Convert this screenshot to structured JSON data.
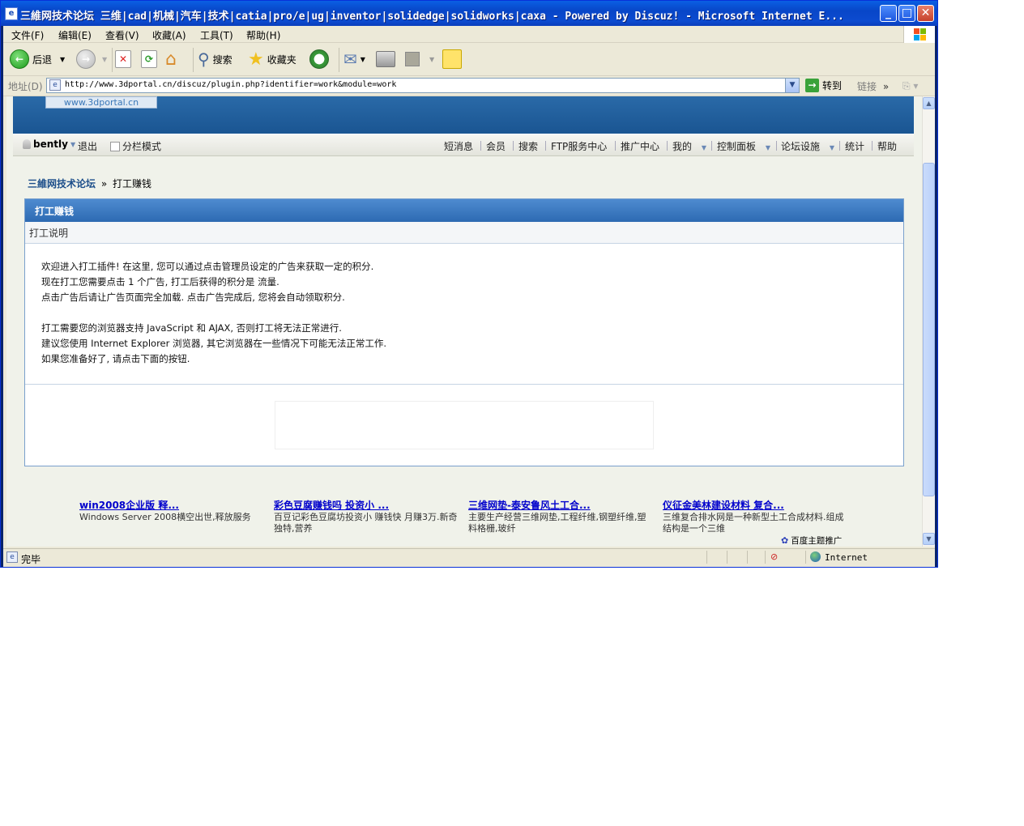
{
  "window": {
    "title": "三維网技术论坛 三维|cad|机械|汽车|技术|catia|pro/e|ug|inventor|solidedge|solidworks|caxa - Powered by Discuz! - Microsoft Internet E...",
    "buttons": {
      "minimize": "_",
      "maximize": "□",
      "close": "✕"
    }
  },
  "menubar": {
    "items": [
      "文件(F)",
      "编辑(E)",
      "查看(V)",
      "收藏(A)",
      "工具(T)",
      "帮助(H)"
    ]
  },
  "toolbar": {
    "back_label": "后退",
    "search_label": "搜索",
    "favorites_label": "收藏夹"
  },
  "address": {
    "label": "地址(D)",
    "url": "http://www.3dportal.cn/discuz/plugin.php?identifier=work&module=work",
    "go_label": "转到",
    "links_label": "链接"
  },
  "page": {
    "logo_text": "www.3dportal.cn",
    "user": {
      "name": "bently",
      "logout": "退出",
      "split_mode": "分栏模式"
    },
    "nav": [
      "短消息",
      "会员",
      "搜索",
      "FTP服务中心",
      "推广中心",
      "我的",
      "控制面板",
      "论坛设施",
      "统计",
      "帮助"
    ],
    "breadcrumb": {
      "home": "三維网技术论坛",
      "sep": "»",
      "current": "打工赚钱"
    },
    "box": {
      "title": "打工赚钱",
      "subtitle": "打工说明",
      "lines": [
        "欢迎进入打工插件! 在这里, 您可以通过点击管理员设定的广告来获取一定的积分.",
        "现在打工您需要点击  1 个广告, 打工后获得的积分是  流量.",
        "点击广告后请让广告页面完全加载. 点击广告完成后, 您将会自动领取积分.",
        "",
        "打工需要您的浏览器支持  JavaScript 和  AJAX, 否则打工将无法正常进行.",
        "建议您使用  Internet Explorer 浏览器, 其它浏览器在一些情况下可能无法正常工作.",
        "如果您准备好了, 请点击下面的按钮."
      ]
    },
    "ads": [
      {
        "title": "win2008企业版 释...",
        "desc": "Windows Server 2008横空出世,释放服务"
      },
      {
        "title": "彩色豆腐赚钱吗 投资小 ...",
        "desc": "百豆记彩色豆腐坊投资小 赚钱快 月赚3万.新奇独特,营养"
      },
      {
        "title": "三维网垫-泰安鲁风土工合...",
        "desc": "主要生产经营三维网垫,工程纤维,钢塑纤维,塑料格栅,玻纤"
      },
      {
        "title": "仪征金美林建设材料 复合...",
        "desc": "三维复合排水网是一种新型土工合成材料.组成结构是一个三维"
      }
    ],
    "baidu_label": "百度主题推广"
  },
  "status": {
    "text": "完毕",
    "zone": "Internet"
  }
}
